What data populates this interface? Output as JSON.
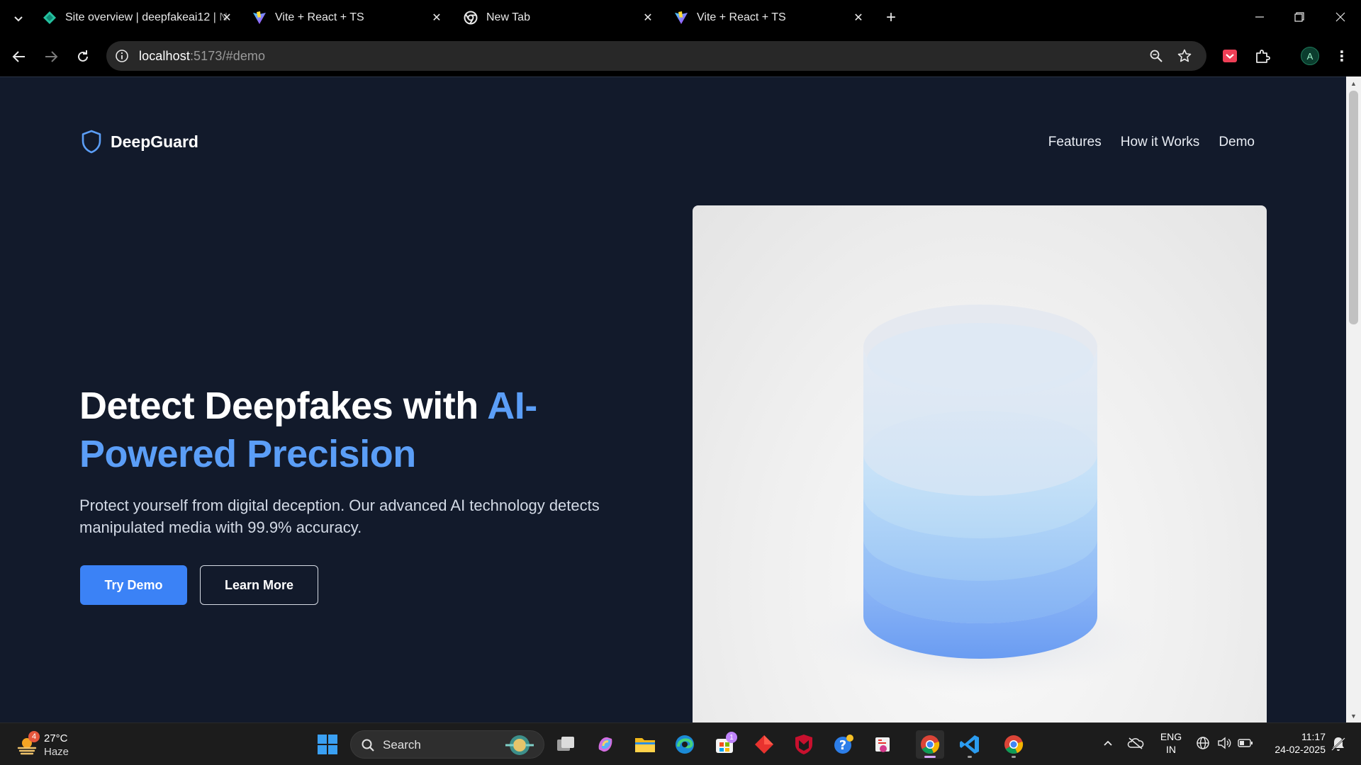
{
  "browser": {
    "tabs": [
      {
        "title": "Site overview | deepfakeai12 | N",
        "icon": "netlify-icon",
        "active": false
      },
      {
        "title": "Vite + React + TS",
        "icon": "vite-icon",
        "active": false
      },
      {
        "title": "New Tab",
        "icon": "chrome-icon",
        "active": false
      },
      {
        "title": "Vite + React + TS",
        "icon": "vite-icon",
        "active": true
      }
    ],
    "address": {
      "host": "localhost",
      "path": ":5173/#demo"
    },
    "profile_initial": "A"
  },
  "page": {
    "brand": "DeepGuard",
    "nav": [
      "Features",
      "How it Works",
      "Demo"
    ],
    "hero": {
      "title_main": "Detect Deepfakes with ",
      "title_accent": "AI-Powered Precision",
      "subtitle": "Protect yourself from digital deception. Our advanced AI technology detects manipulated media with 99.9% accuracy.",
      "primary_button": "Try Demo",
      "secondary_button": "Learn More"
    },
    "colors": {
      "background": "#121a2b",
      "accent": "#5b9ef7",
      "button": "#3b82f6"
    }
  },
  "taskbar": {
    "weather": {
      "temp": "27°C",
      "condition": "Haze",
      "badge": "4"
    },
    "search_label": "Search",
    "store_badge": "1",
    "language": {
      "line1": "ENG",
      "line2": "IN"
    },
    "clock": {
      "time": "11:17",
      "date": "24-02-2025"
    }
  }
}
